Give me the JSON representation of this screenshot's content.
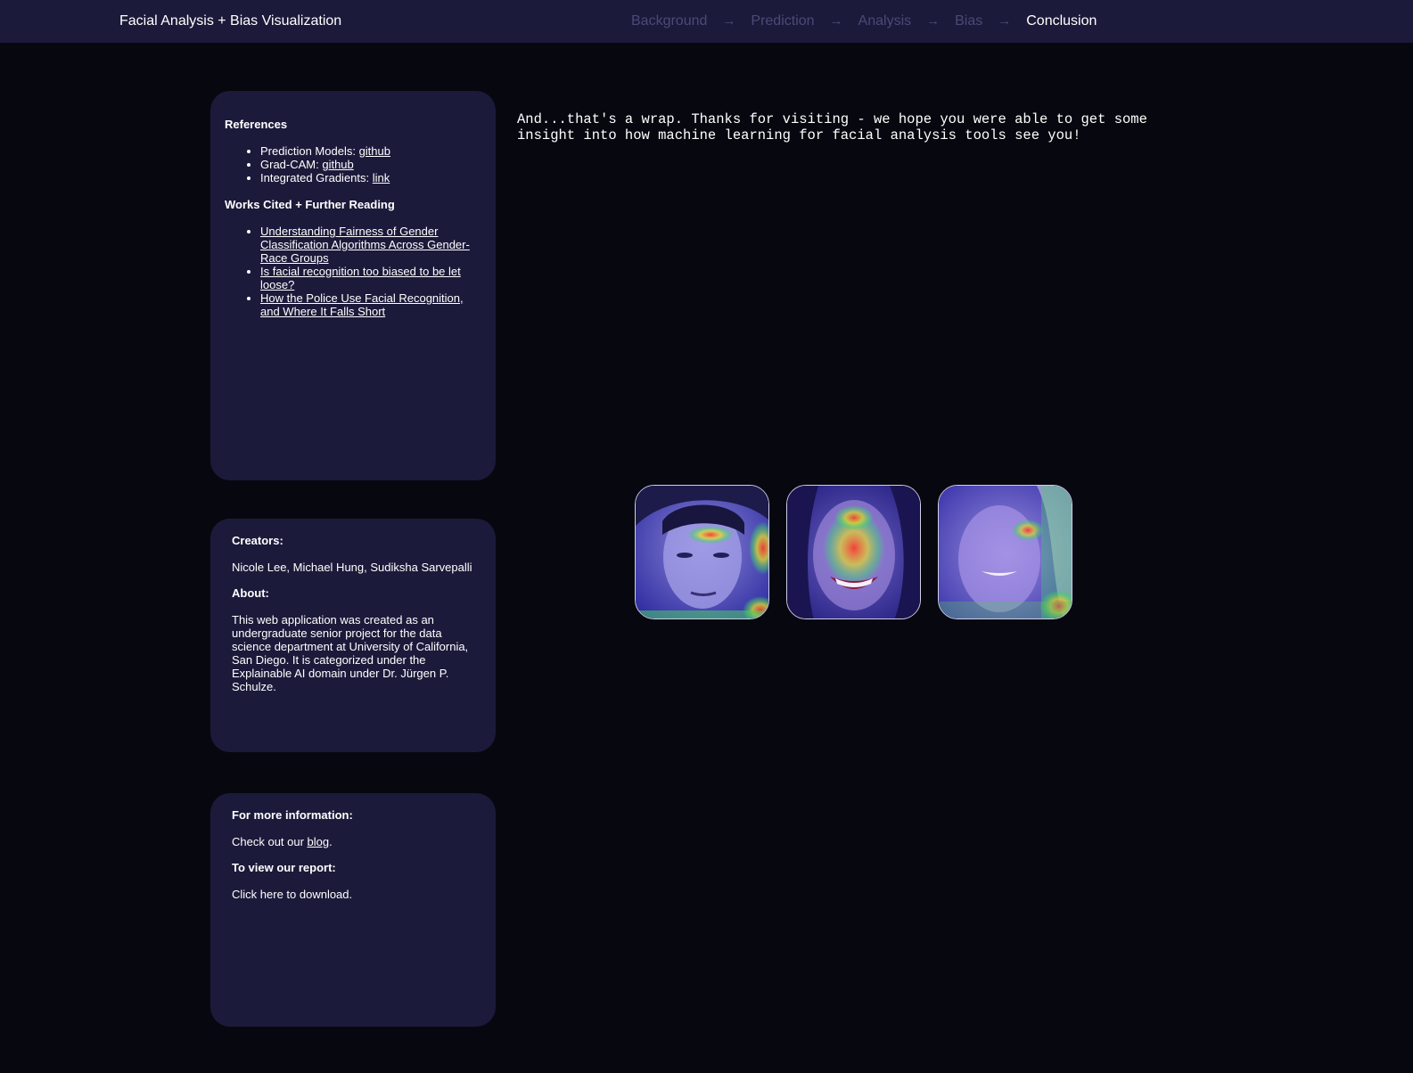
{
  "nav": {
    "title": "Facial Analysis + Bias Visualization",
    "steps": [
      "Background",
      "Prediction",
      "Analysis",
      "Bias",
      "Conclusion"
    ],
    "arrow": "→",
    "active": "Conclusion"
  },
  "references": {
    "heading": "References",
    "items": [
      {
        "label": "Prediction Models: ",
        "link": "github"
      },
      {
        "label": "Grad-CAM: ",
        "link": "github"
      },
      {
        "label": "Integrated Gradients: ",
        "link": "link"
      }
    ],
    "works_heading": "Works Cited + Further Reading",
    "works": [
      "Understanding Fairness of Gender Classification Algorithms Across Gender-Race Groups",
      "Is facial recognition too biased to be let loose?",
      "How the Police Use Facial Recognition, and Where It Falls Short"
    ]
  },
  "about": {
    "creators_heading": "Creators:",
    "creators": "Nicole Lee, Michael Hung, Sudiksha Sarvepalli",
    "about_heading": "About:",
    "about_text": "This web application was created as an undergraduate senior project for the data science department at University of California, San Diego. It is categorized under the Explainable AI domain under Dr. Jürgen P. Schulze."
  },
  "info": {
    "more_heading": "For more information:",
    "more_prefix": "Check out our ",
    "more_link": "blog",
    "more_suffix": ".",
    "report_heading": "To view our report:",
    "report_text": "Click here to download."
  },
  "main": {
    "message": "And...that's a wrap. Thanks for visiting - we hope you were able to get some insight into how machine learning for facial analysis tools see you!"
  },
  "colors": {
    "background": "#07070f",
    "panel": "#1b1a3a",
    "nav_inactive": "#4a4a78",
    "text": "#ffffff"
  }
}
